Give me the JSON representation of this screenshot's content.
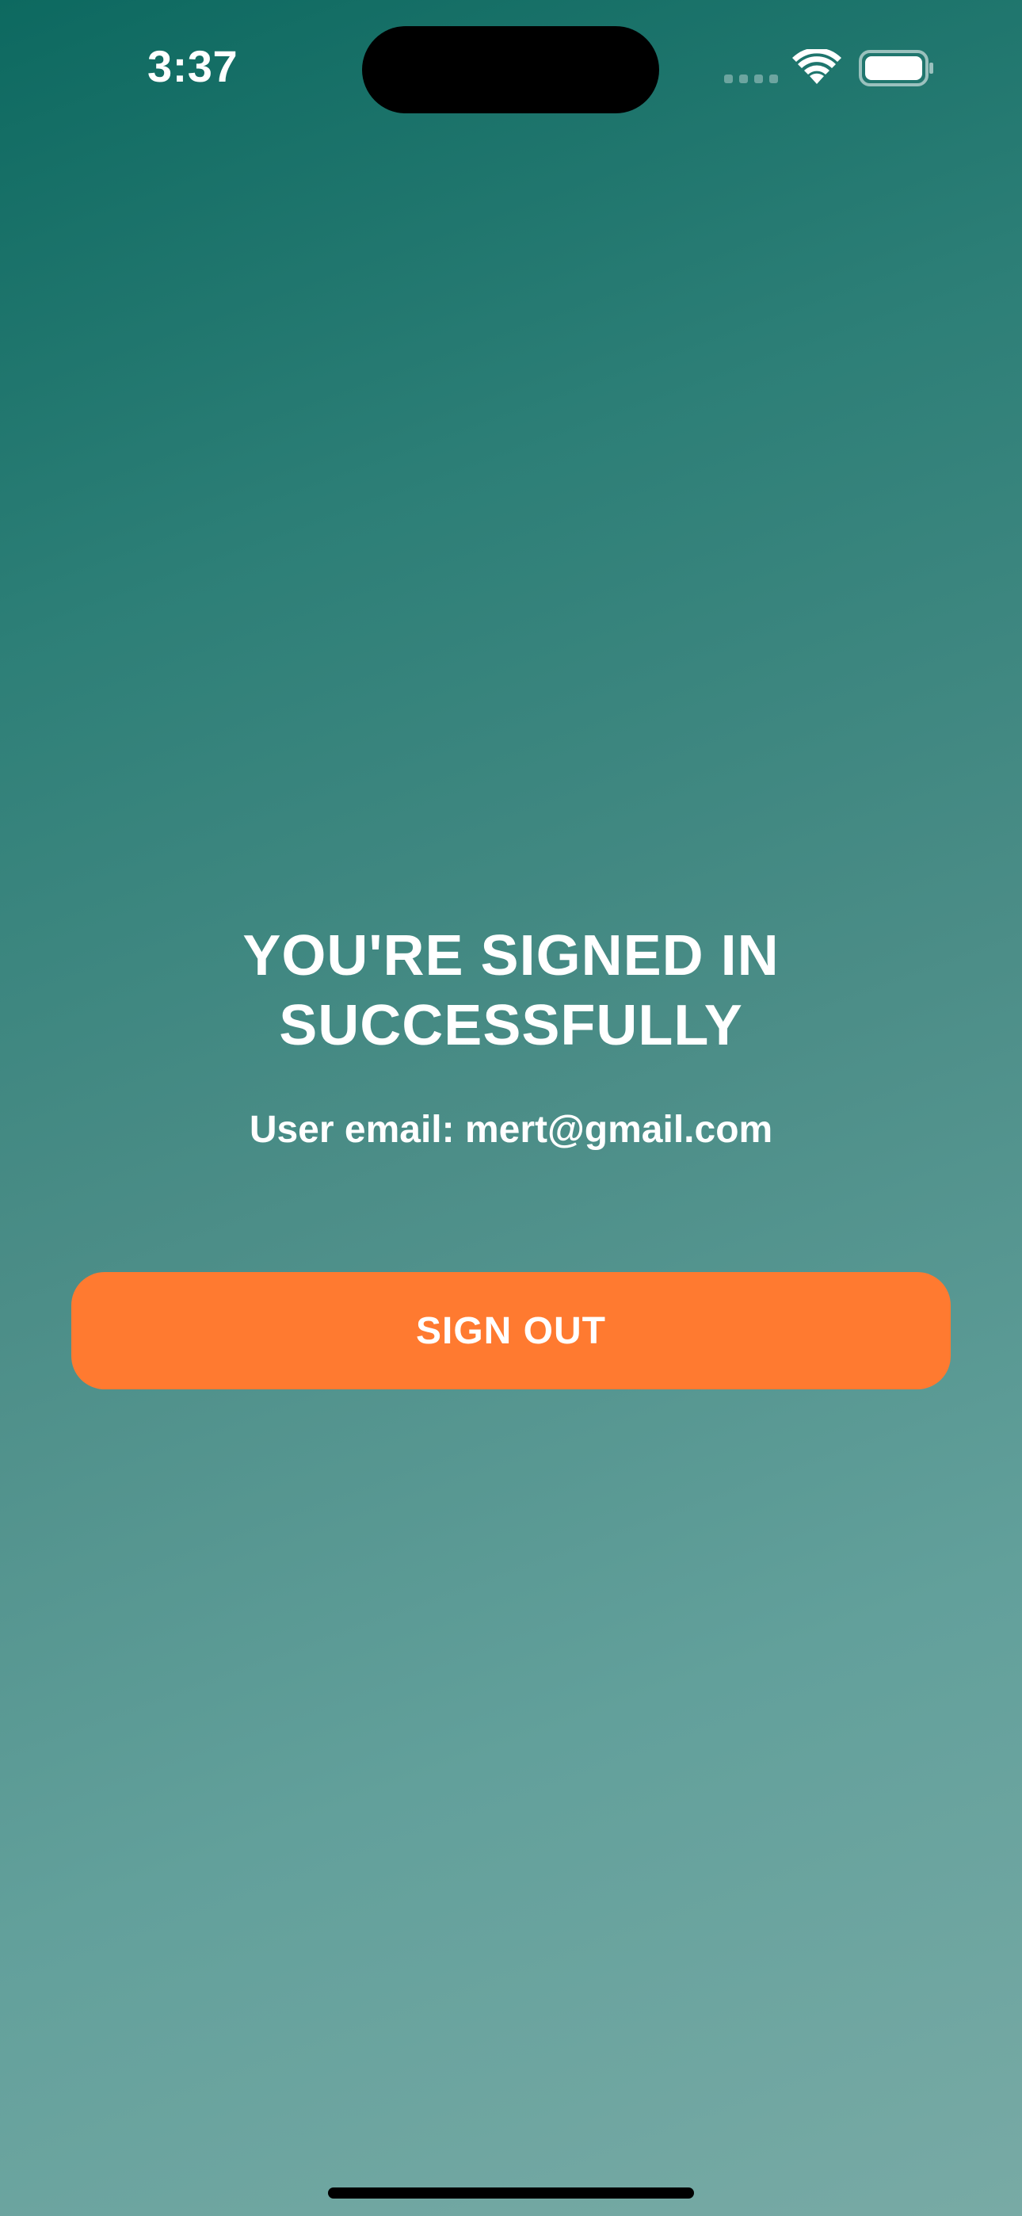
{
  "status_bar": {
    "time": "3:37",
    "icons": [
      "cellular-signal-icon",
      "wifi-icon",
      "battery-icon"
    ]
  },
  "main": {
    "headline_line1": "YOU'RE SIGNED IN",
    "headline_line2": "SUCCESSFULLY",
    "email_text": "User email: mert@gmail.com",
    "signout_label": "SIGN OUT"
  },
  "colors": {
    "gradient_top": "#0d6960",
    "gradient_bottom": "#78aaa5",
    "button_accent": "#ff7a30",
    "text": "#ffffff"
  }
}
